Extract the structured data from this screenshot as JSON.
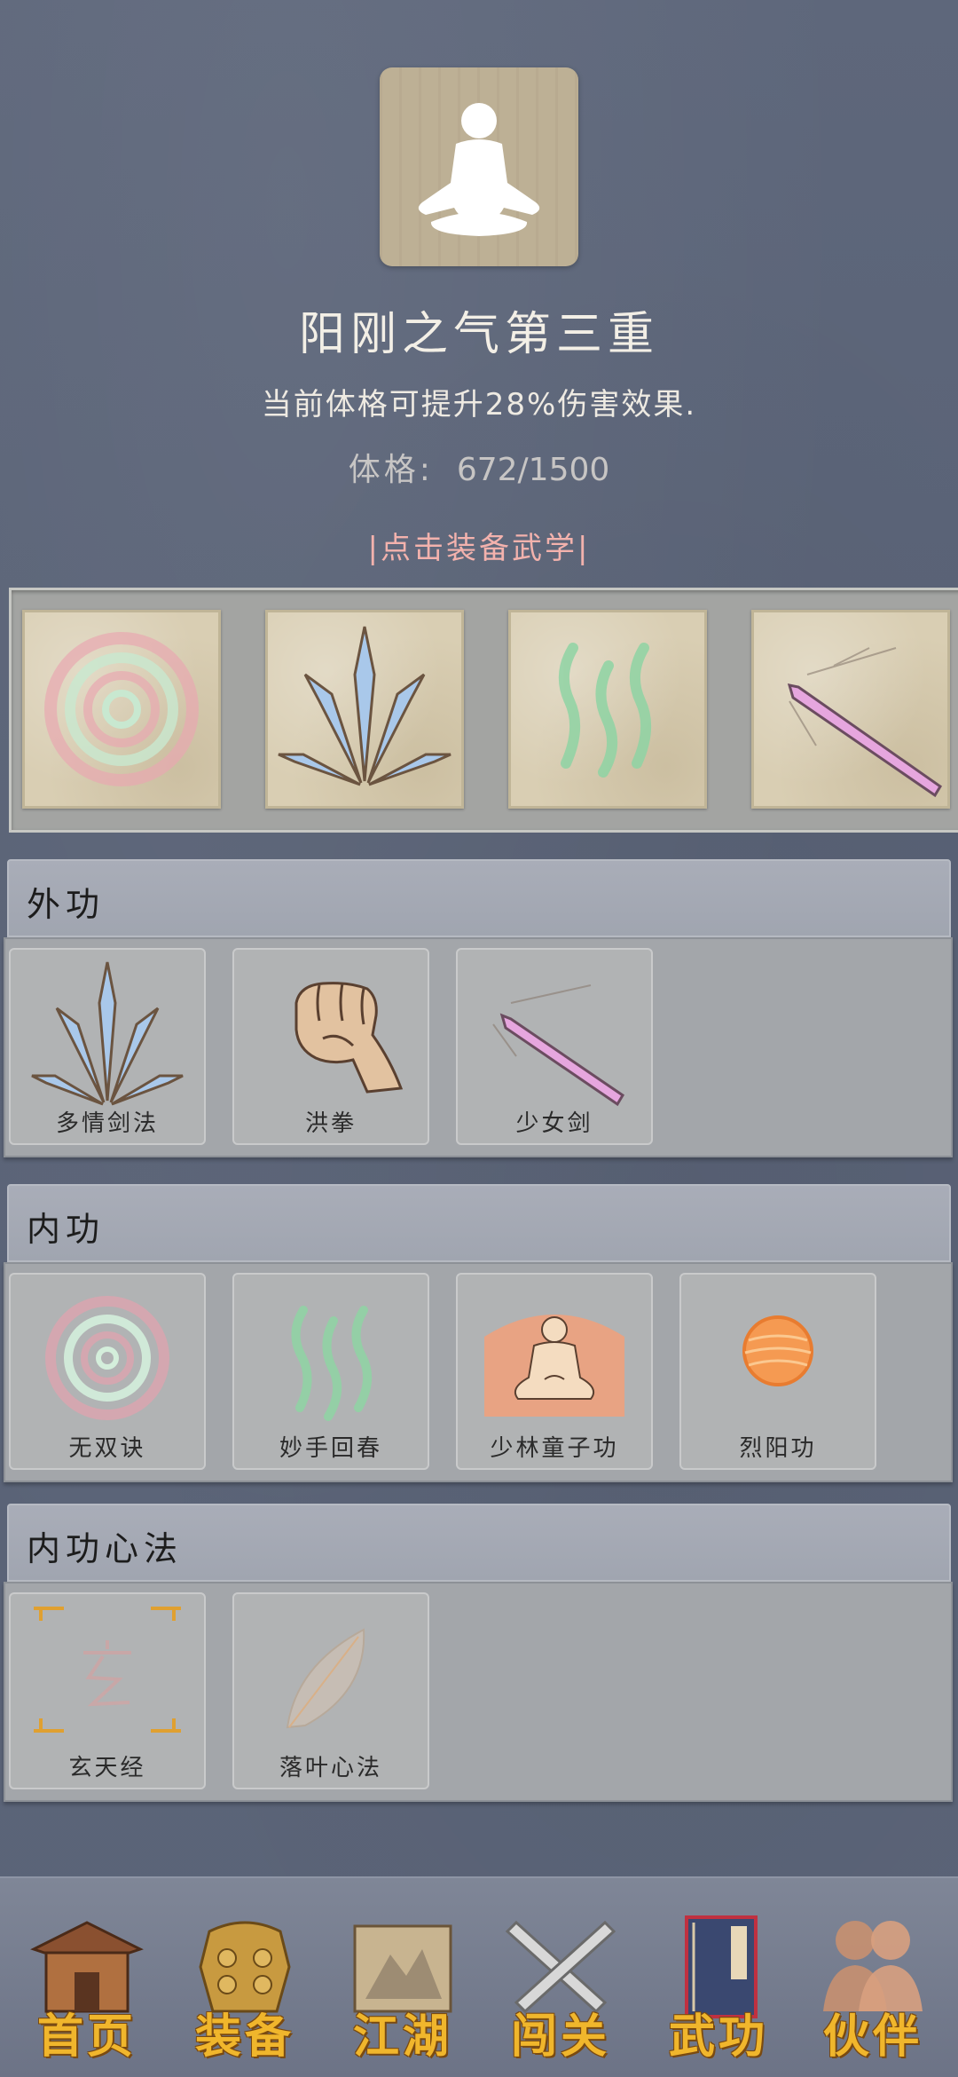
{
  "header": {
    "avatar_icon": "meditating-figure-icon",
    "skill_title": "阳刚之气第三重",
    "skill_desc": "当前体格可提升28%伤害效果.",
    "stat_label": "体格:",
    "stat_value": "672/1500",
    "equip_link": "|点击装备武学|"
  },
  "equipped": [
    {
      "icon": "spiral-swirl-icon"
    },
    {
      "icon": "blue-sword-fan-icon"
    },
    {
      "icon": "green-waves-icon"
    },
    {
      "icon": "pink-sword-icon"
    }
  ],
  "sections": [
    {
      "title": "外功",
      "items": [
        {
          "name": "多情剑法",
          "icon": "blue-sword-fan-icon"
        },
        {
          "name": "洪拳",
          "icon": "fist-icon"
        },
        {
          "name": "少女剑",
          "icon": "pink-sword-icon"
        }
      ]
    },
    {
      "title": "内功",
      "items": [
        {
          "name": "无双诀",
          "icon": "spiral-swirl-icon"
        },
        {
          "name": "妙手回春",
          "icon": "green-waves-icon"
        },
        {
          "name": "少林童子功",
          "icon": "meditating-monk-icon"
        },
        {
          "name": "烈阳功",
          "icon": "orange-sun-icon"
        }
      ]
    },
    {
      "title": "内功心法",
      "items": [
        {
          "name": "玄天经",
          "icon": "xuan-rune-icon"
        },
        {
          "name": "落叶心法",
          "icon": "leaf-icon"
        }
      ]
    }
  ],
  "nav": [
    {
      "label": "首页",
      "icon": "house-icon"
    },
    {
      "label": "装备",
      "icon": "armor-icon"
    },
    {
      "label": "江湖",
      "icon": "scroll-map-icon"
    },
    {
      "label": "闯关",
      "icon": "crossed-swords-icon"
    },
    {
      "label": "武功",
      "icon": "book-icon"
    },
    {
      "label": "伙伴",
      "icon": "companions-icon"
    }
  ],
  "colors": {
    "background": "#5b6478",
    "title_text": "#f3efe6",
    "link_text": "#f3b2ad",
    "nav_label": "#f0b62c"
  }
}
